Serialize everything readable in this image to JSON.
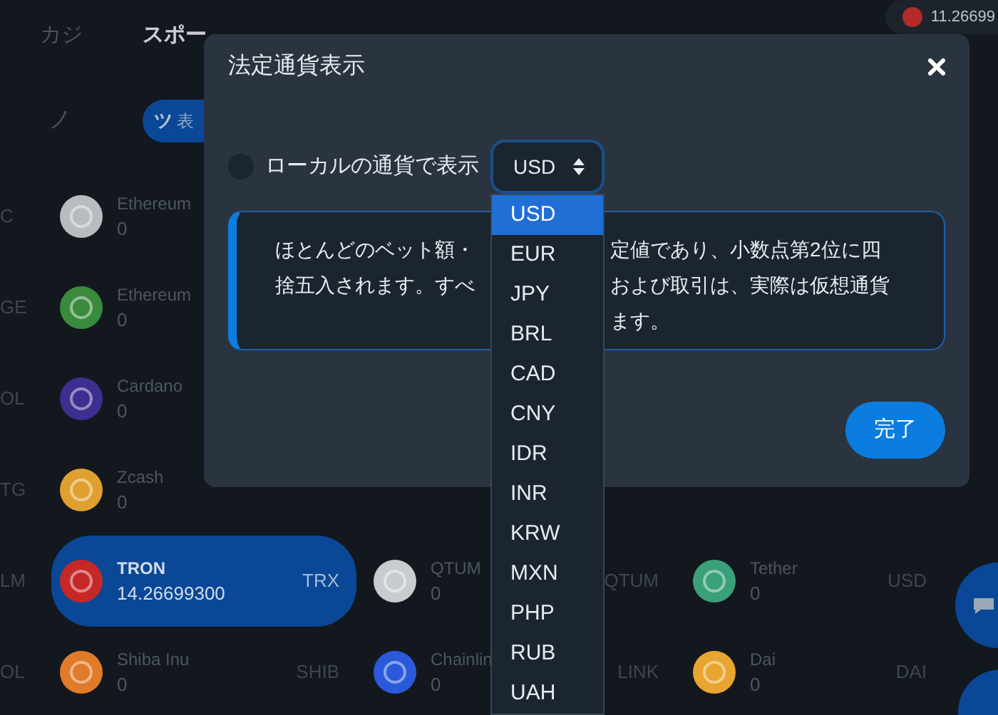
{
  "nav": {
    "tabs": [
      {
        "label": "カジ",
        "selected": false
      },
      {
        "label": "スポー",
        "selected": true
      }
    ],
    "balance": "11.26699"
  },
  "filter": {
    "label": "ノ",
    "pill_icon_text": "ツ",
    "pill_text": "表"
  },
  "side_labels": [
    "C",
    "GE",
    "OL",
    "TG",
    "LM",
    "OL"
  ],
  "coin_columns": [
    {
      "items": [
        {
          "name": "Ethereum",
          "amount": "0",
          "color": "#b8bcc0",
          "selected": false
        },
        {
          "name": "Ethereum",
          "amount": "0",
          "color": "#3a8a3e",
          "selected": false
        },
        {
          "name": "Cardano",
          "amount": "0",
          "color": "#3c2f8f",
          "selected": false
        },
        {
          "name": "Zcash",
          "amount": "0",
          "color": "#e0a030",
          "selected": false
        },
        {
          "name": "TRON",
          "amount": "14.26699300",
          "symbol": "TRX",
          "color": "#c62828",
          "selected": true
        },
        {
          "name": "Shiba Inu",
          "amount": "0",
          "symbol": "SHIB",
          "color": "#e07b2a",
          "selected": false
        }
      ]
    },
    {
      "items": [
        {
          "name": "QTUM",
          "amount": "0",
          "symbol": "QTUM",
          "color": "#c8ccd0",
          "selected": false
        },
        {
          "name": "Chainlin",
          "amount": "0",
          "symbol": "LINK",
          "color": "#2a5ada",
          "selected": false
        }
      ]
    },
    {
      "items": [
        {
          "name": "Tether",
          "amount": "0",
          "symbol": "USD",
          "color": "#3aa07a",
          "selected": false
        },
        {
          "name": "Dai",
          "amount": "0",
          "symbol": "DAI",
          "color": "#e8a530",
          "selected": false
        }
      ]
    }
  ],
  "dialog": {
    "title": "法定通貨表示",
    "local_currency": {
      "label": "ローカルの通貨で表示",
      "checked": false
    },
    "select": {
      "value": "USD",
      "expanded": true,
      "options": [
        {
          "label": "USD",
          "selected": true
        },
        {
          "label": "EUR",
          "selected": false
        },
        {
          "label": "JPY",
          "selected": false
        },
        {
          "label": "BRL",
          "selected": false
        },
        {
          "label": "CAD",
          "selected": false
        },
        {
          "label": "CNY",
          "selected": false
        },
        {
          "label": "IDR",
          "selected": false
        },
        {
          "label": "INR",
          "selected": false
        },
        {
          "label": "KRW",
          "selected": false
        },
        {
          "label": "MXN",
          "selected": false
        },
        {
          "label": "PHP",
          "selected": false
        },
        {
          "label": "RUB",
          "selected": false
        },
        {
          "label": "UAH",
          "selected": false
        }
      ]
    },
    "notice": {
      "left_lines": [
        "ほとんどのベット額・",
        "捨五入されます。すべ"
      ],
      "right_lines": [
        "定値であり、小数点第2位に四",
        "および取引は、実際は仮想通貨",
        "ます。"
      ]
    },
    "done_button": "完了"
  }
}
